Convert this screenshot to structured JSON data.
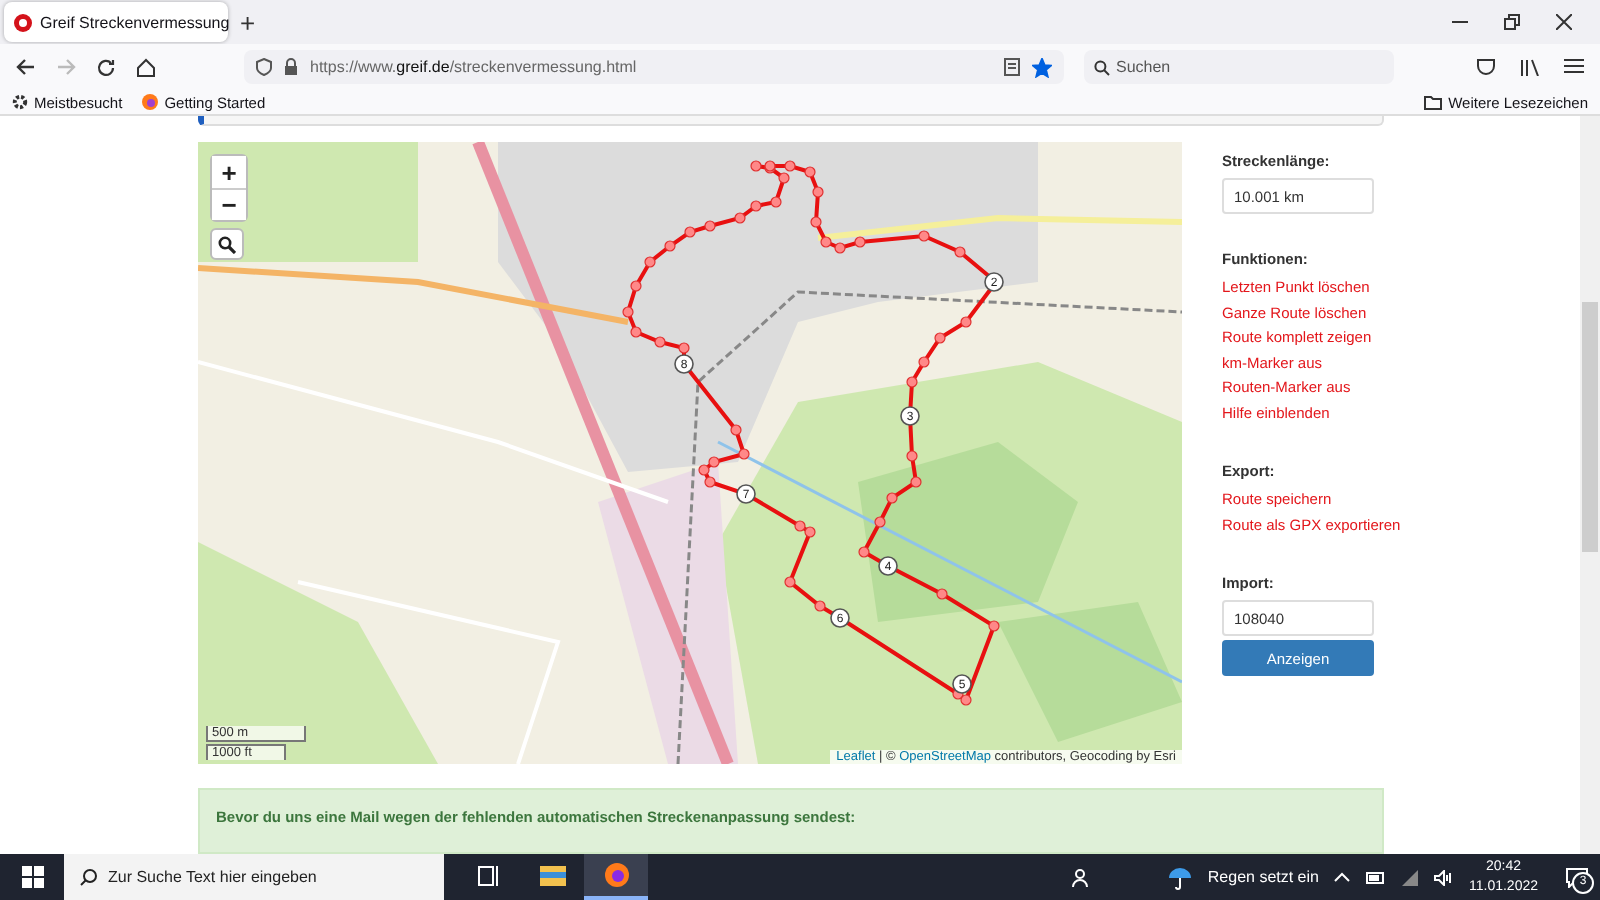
{
  "browser": {
    "tab": {
      "title": "Greif Streckenvermessung",
      "selected": true
    },
    "new_tab": "+",
    "url": {
      "prefix": "https://www.",
      "host": "greif.de",
      "path": "/streckenvermessung.html"
    },
    "bookmarked": true,
    "forward_disabled": true,
    "search": {
      "placeholder": "Suchen"
    },
    "bookmarks": [
      "Meistbesucht",
      "Getting Started"
    ],
    "other_bookmarks": "Weitere Lesezeichen"
  },
  "map": {
    "zoom_in": "+",
    "zoom_out": "−",
    "scale": [
      "500 m",
      "1000 ft"
    ],
    "attribution": {
      "link1": "Leaflet",
      "sep": " | © ",
      "link2": "OpenStreetMap",
      "rest": " contributors, Geocoding by Esri"
    },
    "km_markers": [
      {
        "label": "2"
      },
      {
        "label": "3"
      },
      {
        "label": "4"
      },
      {
        "label": "5"
      },
      {
        "label": "6"
      },
      {
        "label": "7"
      },
      {
        "label": "8"
      }
    ]
  },
  "panel": {
    "length_label": "Streckenlänge:",
    "length_value": "10.001 km",
    "functions_label": "Funktionen:",
    "functions": [
      "Letzten Punkt löschen",
      "Ganze Route löschen",
      "Route komplett zeigen",
      "km-Marker aus",
      "Routen-Marker aus",
      "Hilfe einblenden"
    ],
    "export_label": "Export:",
    "export": [
      "Route speichern",
      "Route als GPX exportieren"
    ],
    "import_label": "Import:",
    "import_value": "108040",
    "import_button": "Anzeigen"
  },
  "notice": {
    "title": "Bevor du uns eine Mail wegen der fehlenden automatischen Streckenanpassung sendest:"
  },
  "taskbar": {
    "search_placeholder": "Zur Suche Text hier eingeben",
    "apps": [
      {
        "kind": "taskview",
        "selected": false
      },
      {
        "kind": "explorer",
        "selected": false
      },
      {
        "kind": "firefox",
        "selected": true
      }
    ],
    "weather": "Regen setzt ein",
    "time": "20:42",
    "date": "11.01.2022",
    "notifications": "3"
  }
}
